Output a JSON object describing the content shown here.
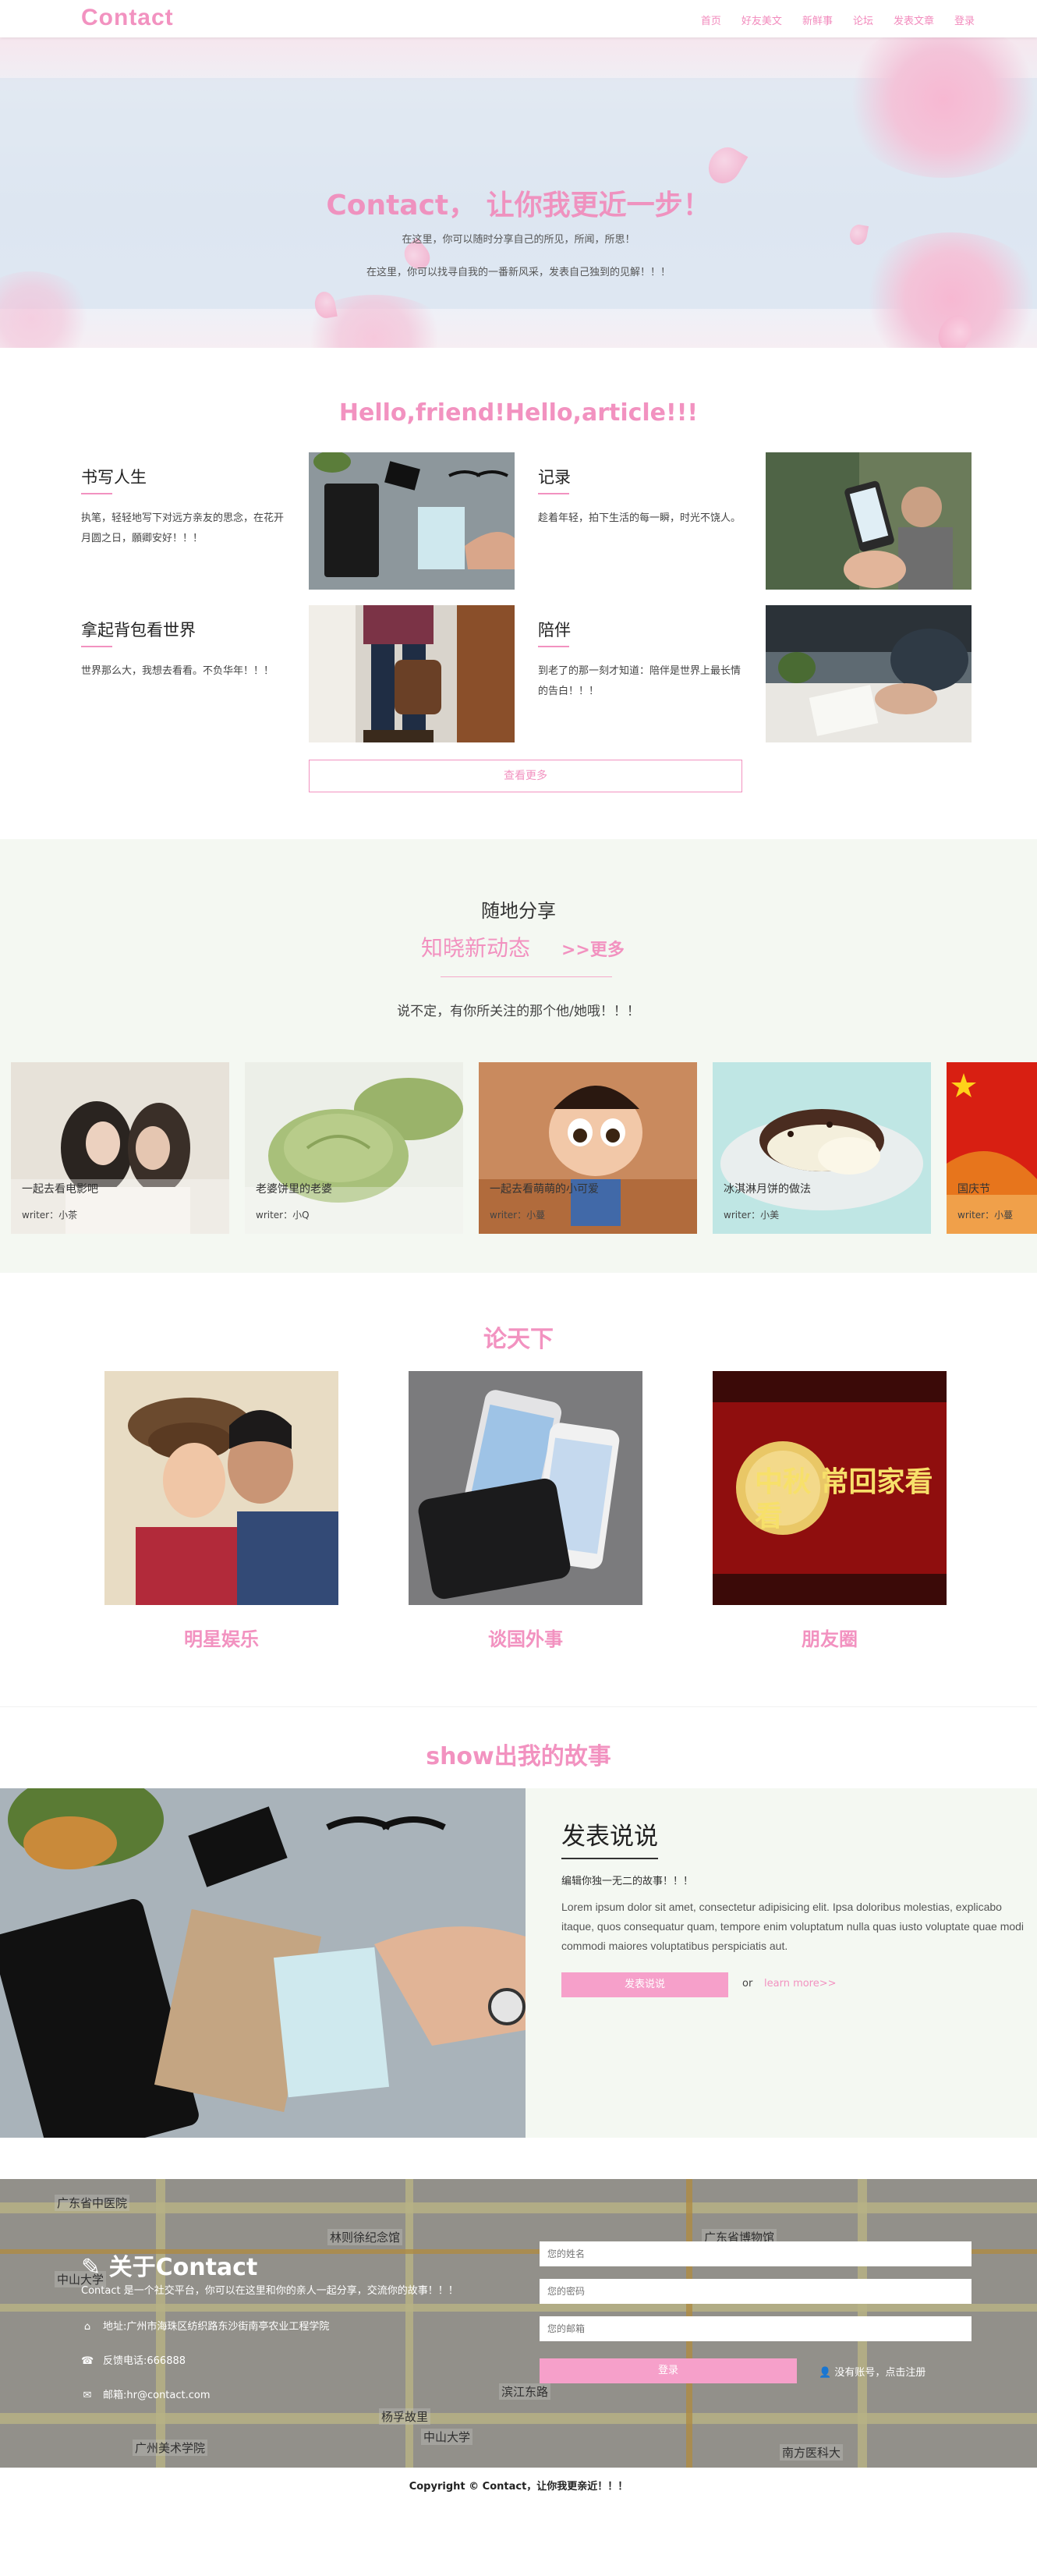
{
  "nav": {
    "brand": "Contact",
    "items": [
      "首页",
      "好友美文",
      "新鲜事",
      "论坛",
      "发表文章",
      "登录"
    ]
  },
  "hero": {
    "title": "Contact， 让你我更近一步！",
    "sub1": "在这里，你可以随时分享自己的所见，所闻，所思！",
    "sub2": "在这里，你可以找寻自我的一番新风采，发表自己独到的见解！！！"
  },
  "section_features": {
    "title": "Hello,friend!Hello,article!!!",
    "items": [
      {
        "title": "书写人生",
        "text": "执笔，轻轻地写下对远方亲友的思念，在花开月圆之日，願卿安好！！！"
      },
      {
        "title": "记录",
        "text": "趁着年轻，拍下生活的每一瞬，时光不饶人。"
      },
      {
        "title": "拿起背包看世界",
        "text": "世界那么大，我想去看看。不负华年！！！"
      },
      {
        "title": "陪伴",
        "text": "到老了的那一刻才知道：陪伴是世界上最长情的告白！！！"
      }
    ],
    "more_button": "查看更多"
  },
  "section_news": {
    "title": "随地分享",
    "subtitle": "知晓新动态",
    "more_link": ">>更多",
    "desc": "说不定，有你所关注的那个他/她哦！！！",
    "cards": [
      {
        "caption": "一起去看电影吧",
        "writer": "writer：小茶"
      },
      {
        "caption": "老婆饼里的老婆",
        "writer": "writer：小Q"
      },
      {
        "caption": "一起去看萌萌的小可爱",
        "writer": "writer：小蔓"
      },
      {
        "caption": "冰淇淋月饼的做法",
        "writer": "writer：小美"
      },
      {
        "caption": "国庆节",
        "writer": "writer：小蔓"
      }
    ]
  },
  "section_topics": {
    "title": "论天下",
    "items": [
      "明星娱乐",
      "谈国外事",
      "朋友圈"
    ],
    "poster_text": "中秋 常回家看看"
  },
  "section_story": {
    "title": "show出我的故事",
    "heading": "发表说说",
    "small": "编辑你独一无二的故事！！！",
    "lorem": "Lorem ipsum dolor sit amet, consectetur adipisicing elit. Ipsa doloribus molestias, explicabo itaque, quos consequatur quam, tempore enim voluptatum nulla quas iusto voluptate quae modi commodi maiores voluptatibus perspiciatis aut.",
    "button": "发表说说",
    "or": "or",
    "learn_more": "learn more>>"
  },
  "footer": {
    "about_title": "关于Contact",
    "about_text": "Contact 是一个社交平台，你可以在这里和你的亲人一起分享，交流你的故事！！！",
    "address": "地址:广州市海珠区纺织路东沙街南亭农业工程学院",
    "phone": "反馈电话:666888",
    "email": "邮箱:hr@contact.com",
    "ph_name": "您的姓名",
    "ph_password": "您的密码",
    "ph_email": "您的邮箱",
    "login_button": "登录",
    "register": "没有账号，点击注册",
    "map_labels": [
      "广东省中医院",
      "林则徐纪念馆",
      "广东省博物馆",
      "中山大学",
      "广州美术学院",
      "滨江东路",
      "中山大学",
      "杨孚故里",
      "南方医科大"
    ],
    "copyright": "Copyright © Contact，让你我更亲近！！！"
  },
  "colors": {
    "accent": "#f292c0",
    "button": "#f6a0ca",
    "band": "#f4f8f2"
  }
}
